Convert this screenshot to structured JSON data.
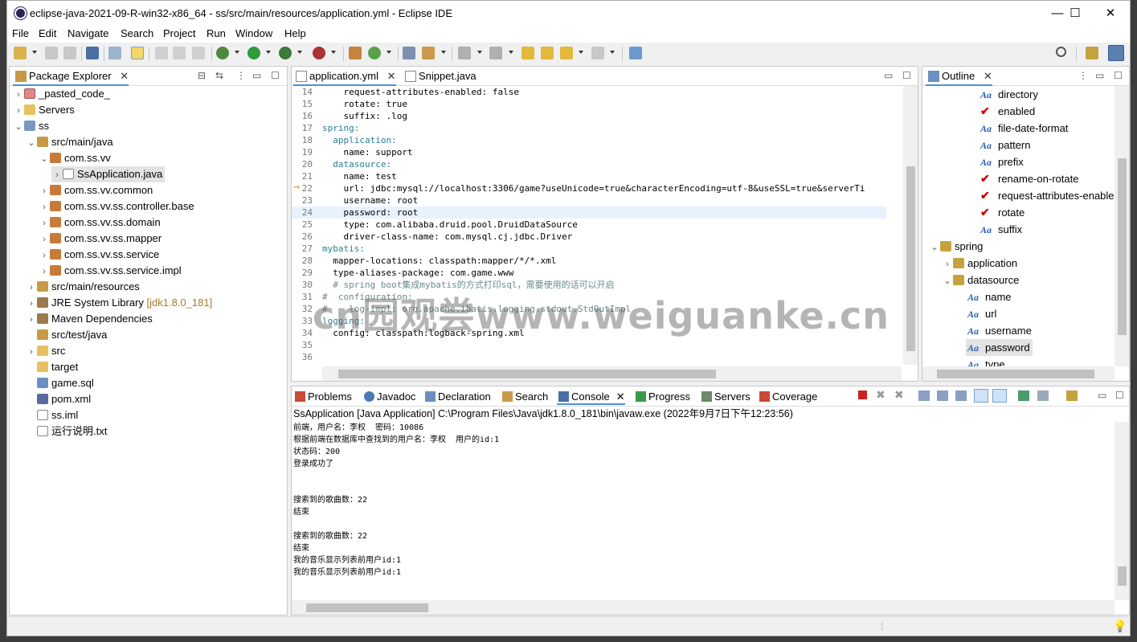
{
  "window": {
    "title": "eclipse-java-2021-09-R-win32-x86_64 - ss/src/main/resources/application.yml - Eclipse IDE",
    "minimize": "—",
    "maximize": "☐",
    "close": "✕"
  },
  "menu": [
    "File",
    "Edit",
    "Navigate",
    "Search",
    "Project",
    "Run",
    "Window",
    "Help"
  ],
  "package_explorer": {
    "tab_label": "Package Explorer",
    "items": [
      {
        "label": "_pasted_code_",
        "extra": ""
      },
      {
        "label": "Servers",
        "extra": ""
      },
      {
        "label": "ss",
        "extra": ""
      },
      {
        "label": "src/main/java",
        "extra": ""
      },
      {
        "label": "com.ss.vv",
        "extra": ""
      },
      {
        "label": "SsApplication.java",
        "extra": ""
      },
      {
        "label": "com.ss.vv.common",
        "extra": ""
      },
      {
        "label": "com.ss.vv.ss.controller.base",
        "extra": ""
      },
      {
        "label": "com.ss.vv.ss.domain",
        "extra": ""
      },
      {
        "label": "com.ss.vv.ss.mapper",
        "extra": ""
      },
      {
        "label": "com.ss.vv.ss.service",
        "extra": ""
      },
      {
        "label": "com.ss.vv.ss.service.impl",
        "extra": ""
      },
      {
        "label": "src/main/resources",
        "extra": ""
      },
      {
        "label": "JRE System Library",
        "extra": "[jdk1.8.0_181]"
      },
      {
        "label": "Maven Dependencies",
        "extra": ""
      },
      {
        "label": "src/test/java",
        "extra": ""
      },
      {
        "label": "src",
        "extra": ""
      },
      {
        "label": "target",
        "extra": ""
      },
      {
        "label": "game.sql",
        "extra": ""
      },
      {
        "label": "pom.xml",
        "extra": ""
      },
      {
        "label": "ss.iml",
        "extra": ""
      },
      {
        "label": "运行说明.txt",
        "extra": ""
      }
    ]
  },
  "editor": {
    "tabs": [
      "application.yml",
      "Snippet.java"
    ],
    "lines": [
      {
        "n": "14",
        "t": "    request-attributes-enabled: false"
      },
      {
        "n": "15",
        "t": "    rotate: true"
      },
      {
        "n": "16",
        "t": "    suffix: .log"
      },
      {
        "n": "17",
        "t": "spring:"
      },
      {
        "n": "18",
        "t": "  application:"
      },
      {
        "n": "19",
        "t": "    name: support"
      },
      {
        "n": "20",
        "t": "  datasource:"
      },
      {
        "n": "21",
        "t": "    name: test"
      },
      {
        "n": "22",
        "t": "    url: jdbc:mysql://localhost:3306/game?useUnicode=true&characterEncoding=utf-8&useSSL=true&serverTi"
      },
      {
        "n": "23",
        "t": "    username: root"
      },
      {
        "n": "24",
        "t": "    password: root"
      },
      {
        "n": "25",
        "t": "    type: com.alibaba.druid.pool.DruidDataSource"
      },
      {
        "n": "26",
        "t": "    driver-class-name: com.mysql.cj.jdbc.Driver"
      },
      {
        "n": "27",
        "t": "mybatis:"
      },
      {
        "n": "28",
        "t": "  mapper-locations: classpath:mapper/*/*.xml"
      },
      {
        "n": "29",
        "t": "  type-aliases-package: com.game.www"
      },
      {
        "n": "30",
        "t": "  # spring boot集成mybatis的方式打印sql，需要使用的话可以开启"
      },
      {
        "n": "31",
        "t": "#  configuration:"
      },
      {
        "n": "32",
        "t": "#    log-impl: org.apache.ibatis.logging.stdout.StdOutImpl"
      },
      {
        "n": "33",
        "t": "logging:"
      },
      {
        "n": "34",
        "t": "  config: classpath:logback-spring.xml"
      },
      {
        "n": "35",
        "t": ""
      },
      {
        "n": "36",
        "t": ""
      }
    ]
  },
  "outline": {
    "tab_label": "Outline",
    "items": [
      {
        "label": "directory",
        "icon": "aa"
      },
      {
        "label": "enabled",
        "icon": "err"
      },
      {
        "label": "file-date-format",
        "icon": "aa"
      },
      {
        "label": "pattern",
        "icon": "aa"
      },
      {
        "label": "prefix",
        "icon": "aa"
      },
      {
        "label": "rename-on-rotate",
        "icon": "err"
      },
      {
        "label": "request-attributes-enable",
        "icon": "err"
      },
      {
        "label": "rotate",
        "icon": "err"
      },
      {
        "label": "suffix",
        "icon": "aa"
      },
      {
        "label": "spring",
        "icon": "map"
      },
      {
        "label": "application",
        "icon": "map"
      },
      {
        "label": "datasource",
        "icon": "map"
      },
      {
        "label": "name",
        "icon": "aa"
      },
      {
        "label": "url",
        "icon": "aa"
      },
      {
        "label": "username",
        "icon": "aa"
      },
      {
        "label": "password",
        "icon": "aa"
      },
      {
        "label": "type",
        "icon": "aa"
      }
    ]
  },
  "console": {
    "tabs": [
      "Problems",
      "Javadoc",
      "Declaration",
      "Search",
      "Console",
      "Progress",
      "Servers",
      "Coverage"
    ],
    "header": "SsApplication [Java Application] C:\\Program Files\\Java\\jdk1.8.0_181\\bin\\javaw.exe  (2022年9月7日下午12:23:56)",
    "lines": [
      "前端，用户名：李权  密码：10086",
      "根据前端在数据库中查找到的用户名：李权  用户的id:1",
      "状态码：200",
      "登录成功了",
      "",
      "",
      "搜索到的歌曲数：22",
      "结束",
      "",
      "搜索到的歌曲数：22",
      "结束",
      "我的音乐显示列表前用户id:1",
      "我的音乐显示列表前用户id:1"
    ]
  },
  "watermark": "cn园观尝www.weiguanke.cn",
  "colors": {
    "accent": "#4a90d9",
    "key": "#2a7f96",
    "value": "#2a5db0",
    "error": "#d00000"
  }
}
